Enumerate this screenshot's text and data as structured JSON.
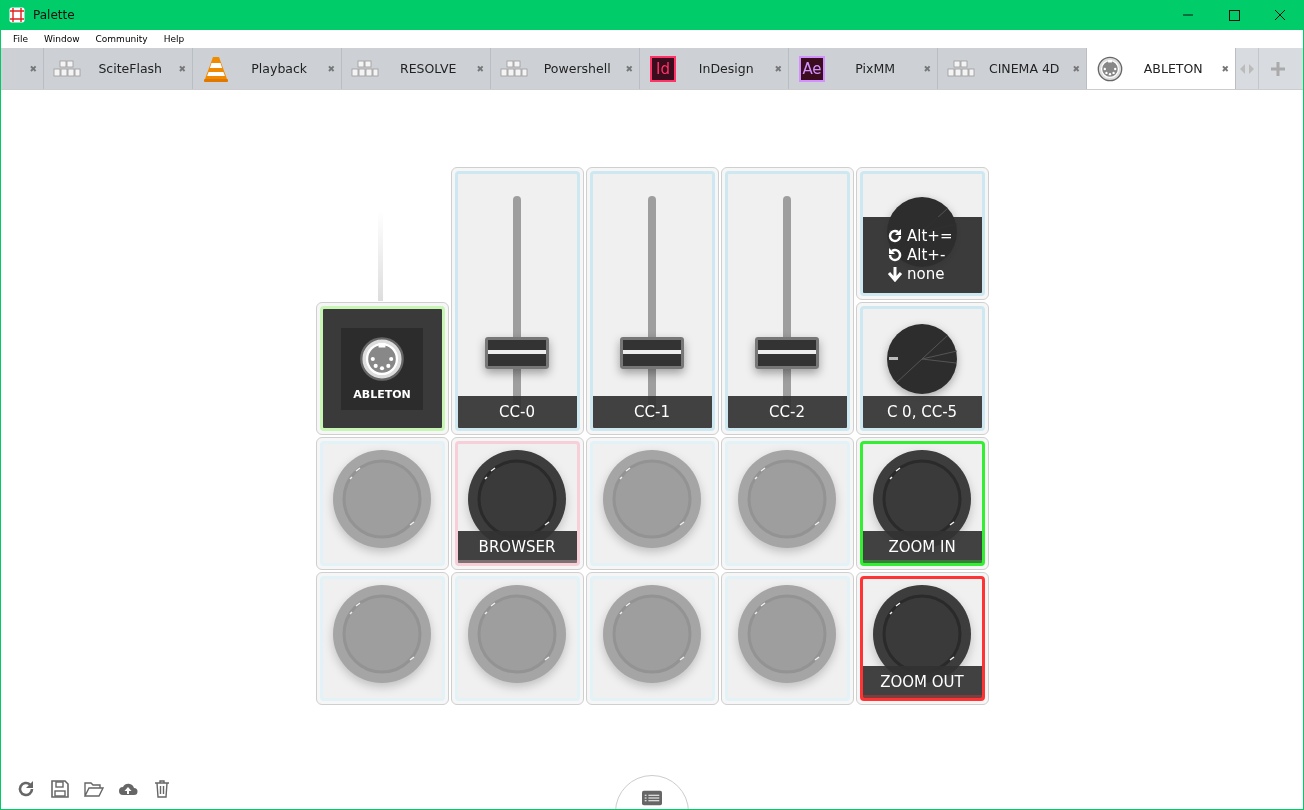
{
  "window": {
    "title": "Palette"
  },
  "menu": [
    "File",
    "Window",
    "Community",
    "Help"
  ],
  "tabs": [
    {
      "kind": "partial",
      "close": "✖",
      "selected": false
    },
    {
      "kind": "keys",
      "label": "SciteFlash",
      "close": "✖",
      "selected": false
    },
    {
      "kind": "cone",
      "label": "Playback",
      "close": "✖",
      "selected": false
    },
    {
      "kind": "keys",
      "label": "RESOLVE",
      "close": "✖",
      "selected": false
    },
    {
      "kind": "keys",
      "label": "Powershell",
      "close": "✖",
      "selected": false
    },
    {
      "kind": "badge",
      "badge": "Id",
      "color": "#ff3366",
      "label": "InDesign",
      "close": "✖",
      "selected": false
    },
    {
      "kind": "badge",
      "badge": "Ae",
      "color": "#d291ff",
      "label": "PixMM",
      "close": "✖",
      "selected": false
    },
    {
      "kind": "keys",
      "label": "CINEMA 4D",
      "close": "✖",
      "selected": false
    },
    {
      "kind": "midi",
      "label": "ABLETON",
      "close": "✖",
      "selected": true
    }
  ],
  "modules": [
    {
      "kind": "slider",
      "label": "CC-0",
      "level": 0.3,
      "color": "#cde8f0"
    },
    {
      "kind": "slider",
      "label": "CC-1",
      "level": 0.3,
      "color": "#cde8f0"
    },
    {
      "kind": "slider",
      "label": "CC-2",
      "level": 0.3,
      "color": "#cde8f0"
    },
    {
      "kind": "dial",
      "color": "#cde8f0",
      "actions": [
        {
          "kind": "cw",
          "text": "Alt+="
        },
        {
          "kind": "ccw",
          "text": "Alt+-"
        },
        {
          "kind": "press",
          "text": "none"
        }
      ]
    },
    {
      "kind": "core",
      "label": "ABLETON",
      "color": "#c6f5b4"
    },
    {
      "kind": "dial",
      "label": "C 0, CC-5",
      "color": "#cde8f0"
    },
    {
      "kind": "button",
      "assigned": false,
      "color": "#e2f2f7"
    },
    {
      "kind": "button",
      "assigned": true,
      "label": "BROWSER",
      "color": "#f7cfd8"
    },
    {
      "kind": "button",
      "assigned": false,
      "color": "#e2f2f7"
    },
    {
      "kind": "button",
      "assigned": false,
      "color": "#e2f2f7"
    },
    {
      "kind": "button",
      "assigned": true,
      "label": "ZOOM IN",
      "color": "#33ee33"
    },
    {
      "kind": "button",
      "assigned": false,
      "color": "#e2f2f7"
    },
    {
      "kind": "button",
      "assigned": false,
      "color": "#e2f2f7"
    },
    {
      "kind": "button",
      "assigned": false,
      "color": "#e2f2f7"
    },
    {
      "kind": "button",
      "assigned": false,
      "color": "#e2f2f7"
    },
    {
      "kind": "button",
      "assigned": true,
      "label": "ZOOM OUT",
      "color": "#ff3333"
    }
  ]
}
